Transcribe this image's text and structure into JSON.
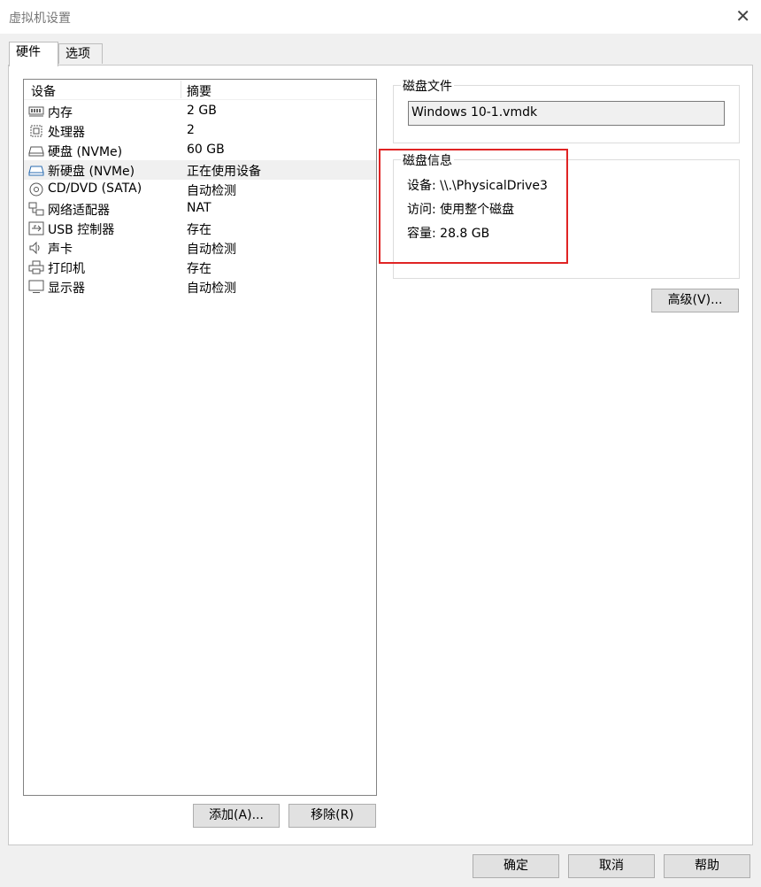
{
  "window": {
    "title": "虚拟机设置"
  },
  "tabs": [
    {
      "label": "硬件"
    },
    {
      "label": "选项"
    }
  ],
  "device_list": {
    "columns": [
      "设备",
      "摘要"
    ],
    "rows": [
      {
        "name": "内存",
        "summary": "2 GB",
        "icon": "memory-icon"
      },
      {
        "name": "处理器",
        "summary": "2",
        "icon": "processor-icon"
      },
      {
        "name": "硬盘 (NVMe)",
        "summary": "60 GB",
        "icon": "hard-disk-icon"
      },
      {
        "name": "新硬盘 (NVMe)",
        "summary": "正在使用设备",
        "icon": "hard-disk-icon",
        "selected": true
      },
      {
        "name": "CD/DVD (SATA)",
        "summary": "自动检测",
        "icon": "cd-dvd-icon"
      },
      {
        "name": "网络适配器",
        "summary": "NAT",
        "icon": "network-adapter-icon"
      },
      {
        "name": "USB 控制器",
        "summary": "存在",
        "icon": "usb-controller-icon"
      },
      {
        "name": "声卡",
        "summary": "自动检测",
        "icon": "sound-card-icon"
      },
      {
        "name": "打印机",
        "summary": "存在",
        "icon": "printer-icon"
      },
      {
        "name": "显示器",
        "summary": "自动检测",
        "icon": "display-icon"
      }
    ]
  },
  "list_buttons": {
    "add": "添加(A)...",
    "remove": "移除(R)"
  },
  "disk_file": {
    "legend": "磁盘文件",
    "value": "Windows 10-1.vmdk"
  },
  "disk_info": {
    "legend": "磁盘信息",
    "device": "设备:  \\\\.\\PhysicalDrive3",
    "access": "访问:  使用整个磁盘",
    "capacity": "容量: 28.8 GB"
  },
  "advanced_button": "高级(V)...",
  "footer": {
    "ok": "确定",
    "cancel": "取消",
    "help": "帮助"
  },
  "colors": {
    "highlight": "#e02424",
    "selected_row": "#f0f0f0"
  }
}
